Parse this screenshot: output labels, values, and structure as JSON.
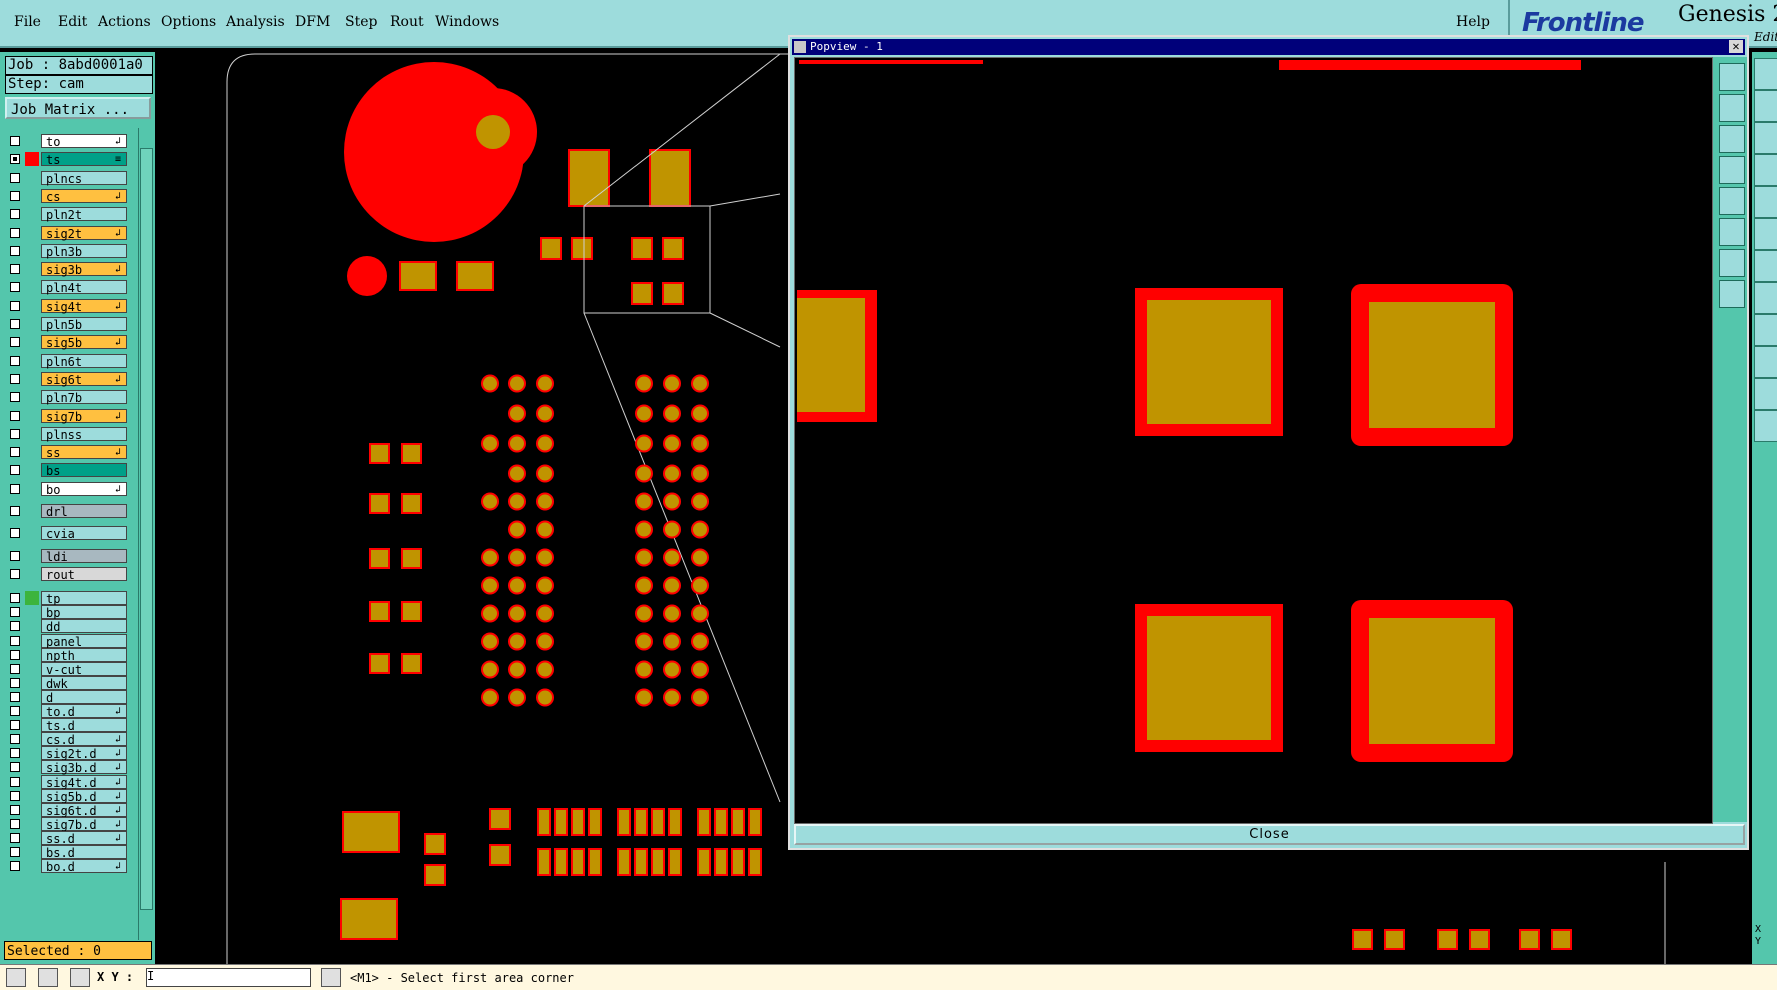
{
  "menubar": {
    "items": [
      "File",
      "Edit",
      "Actions",
      "Options",
      "Analysis",
      "DFM",
      "Step",
      "Rout",
      "Windows"
    ],
    "help": "Help"
  },
  "brand": {
    "logo": "Frontline",
    "product": "Genesis 2",
    "edition": "Edit"
  },
  "job": {
    "job_line": "Job : 8abd0001a0",
    "step_line": "Step: cam",
    "matrix_button": "Job Matrix ..."
  },
  "layers": [
    {
      "name": "to",
      "color": "#ffffff",
      "board": true,
      "arrow": "↲"
    },
    {
      "name": "ts",
      "color": "#00a088",
      "board": true,
      "arrow": "≡",
      "swatch": "#ff0000",
      "checked": true
    },
    {
      "name": "plncs",
      "color": "#9ddcdc",
      "board": true,
      "arrow": ""
    },
    {
      "name": "cs",
      "color": "#ffc040",
      "board": true,
      "arrow": "↲"
    },
    {
      "name": "pln2t",
      "color": "#9ddcdc",
      "board": true,
      "arrow": ""
    },
    {
      "name": "sig2t",
      "color": "#ffc040",
      "board": true,
      "arrow": "↲"
    },
    {
      "name": "pln3b",
      "color": "#9ddcdc",
      "board": true,
      "arrow": ""
    },
    {
      "name": "sig3b",
      "color": "#ffc040",
      "board": true,
      "arrow": "↲"
    },
    {
      "name": "pln4t",
      "color": "#9ddcdc",
      "board": true,
      "arrow": ""
    },
    {
      "name": "sig4t",
      "color": "#ffc040",
      "board": true,
      "arrow": "↲"
    },
    {
      "name": "pln5b",
      "color": "#9ddcdc",
      "board": true,
      "arrow": ""
    },
    {
      "name": "sig5b",
      "color": "#ffc040",
      "board": true,
      "arrow": "↲"
    },
    {
      "name": "pln6t",
      "color": "#9ddcdc",
      "board": true,
      "arrow": ""
    },
    {
      "name": "sig6t",
      "color": "#ffc040",
      "board": true,
      "arrow": "↲"
    },
    {
      "name": "pln7b",
      "color": "#9ddcdc",
      "board": true,
      "arrow": ""
    },
    {
      "name": "sig7b",
      "color": "#ffc040",
      "board": true,
      "arrow": "↲"
    },
    {
      "name": "plnss",
      "color": "#9ddcdc",
      "board": true,
      "arrow": ""
    },
    {
      "name": "ss",
      "color": "#ffc040",
      "board": true,
      "arrow": "↲"
    },
    {
      "name": "bs",
      "color": "#00a088",
      "board": true,
      "arrow": ""
    },
    {
      "name": "bo",
      "color": "#ffffff",
      "board": true,
      "arrow": "↲"
    },
    {
      "name": "drl",
      "color": "#a8b8c0",
      "board": true,
      "arrow": ""
    },
    {
      "name": "cvia",
      "color": "#9ddcdc",
      "board": true,
      "arrow": ""
    },
    {
      "name": "ldi",
      "color": "#a8b8c0",
      "board": true,
      "arrow": ""
    },
    {
      "name": "rout",
      "color": "#d8d8d8",
      "board": true,
      "arrow": ""
    },
    {
      "name": "tp",
      "color": "#9ddcdc",
      "board": false,
      "arrow": "",
      "swatch": "#3cb43c"
    },
    {
      "name": "bp",
      "color": "#9ddcdc",
      "board": false,
      "arrow": ""
    },
    {
      "name": "dd",
      "color": "#9ddcdc",
      "board": false,
      "arrow": ""
    },
    {
      "name": "panel",
      "color": "#9ddcdc",
      "board": false,
      "arrow": ""
    },
    {
      "name": "npth",
      "color": "#9ddcdc",
      "board": false,
      "arrow": ""
    },
    {
      "name": "v-cut",
      "color": "#9ddcdc",
      "board": false,
      "arrow": ""
    },
    {
      "name": "dwk",
      "color": "#9ddcdc",
      "board": false,
      "arrow": ""
    },
    {
      "name": "d",
      "color": "#9ddcdc",
      "board": false,
      "arrow": ""
    },
    {
      "name": "to.d",
      "color": "#9ddcdc",
      "board": false,
      "arrow": "↲"
    },
    {
      "name": "ts.d",
      "color": "#9ddcdc",
      "board": false,
      "arrow": ""
    },
    {
      "name": "cs.d",
      "color": "#9ddcdc",
      "board": false,
      "arrow": "↲"
    },
    {
      "name": "sig2t.d",
      "color": "#9ddcdc",
      "board": false,
      "arrow": "↲"
    },
    {
      "name": "sig3b.d",
      "color": "#9ddcdc",
      "board": false,
      "arrow": "↲"
    },
    {
      "name": "sig4t.d",
      "color": "#9ddcdc",
      "board": false,
      "arrow": "↲"
    },
    {
      "name": "sig5b.d",
      "color": "#9ddcdc",
      "board": false,
      "arrow": "↲"
    },
    {
      "name": "sig6t.d",
      "color": "#9ddcdc",
      "board": false,
      "arrow": "↲"
    },
    {
      "name": "sig7b.d",
      "color": "#9ddcdc",
      "board": false,
      "arrow": "↲"
    },
    {
      "name": "ss.d",
      "color": "#9ddcdc",
      "board": false,
      "arrow": "↲"
    },
    {
      "name": "bs.d",
      "color": "#9ddcdc",
      "board": false,
      "arrow": ""
    },
    {
      "name": "bo.d",
      "color": "#9ddcdc",
      "board": false,
      "arrow": "↲"
    }
  ],
  "selected_text": "Selected : 0",
  "popview": {
    "title": "Popview - 1",
    "close_label": "Close"
  },
  "status": {
    "xy_label": "X Y :",
    "input_value": "I",
    "prompt": "<M1> - Select first area corner"
  },
  "right_corner": "X\nY",
  "colors": {
    "pad_fill": "#c09400",
    "pad_outline": "#ff0000",
    "panel": "#54c6ac",
    "bar": "#9ddcdc"
  }
}
